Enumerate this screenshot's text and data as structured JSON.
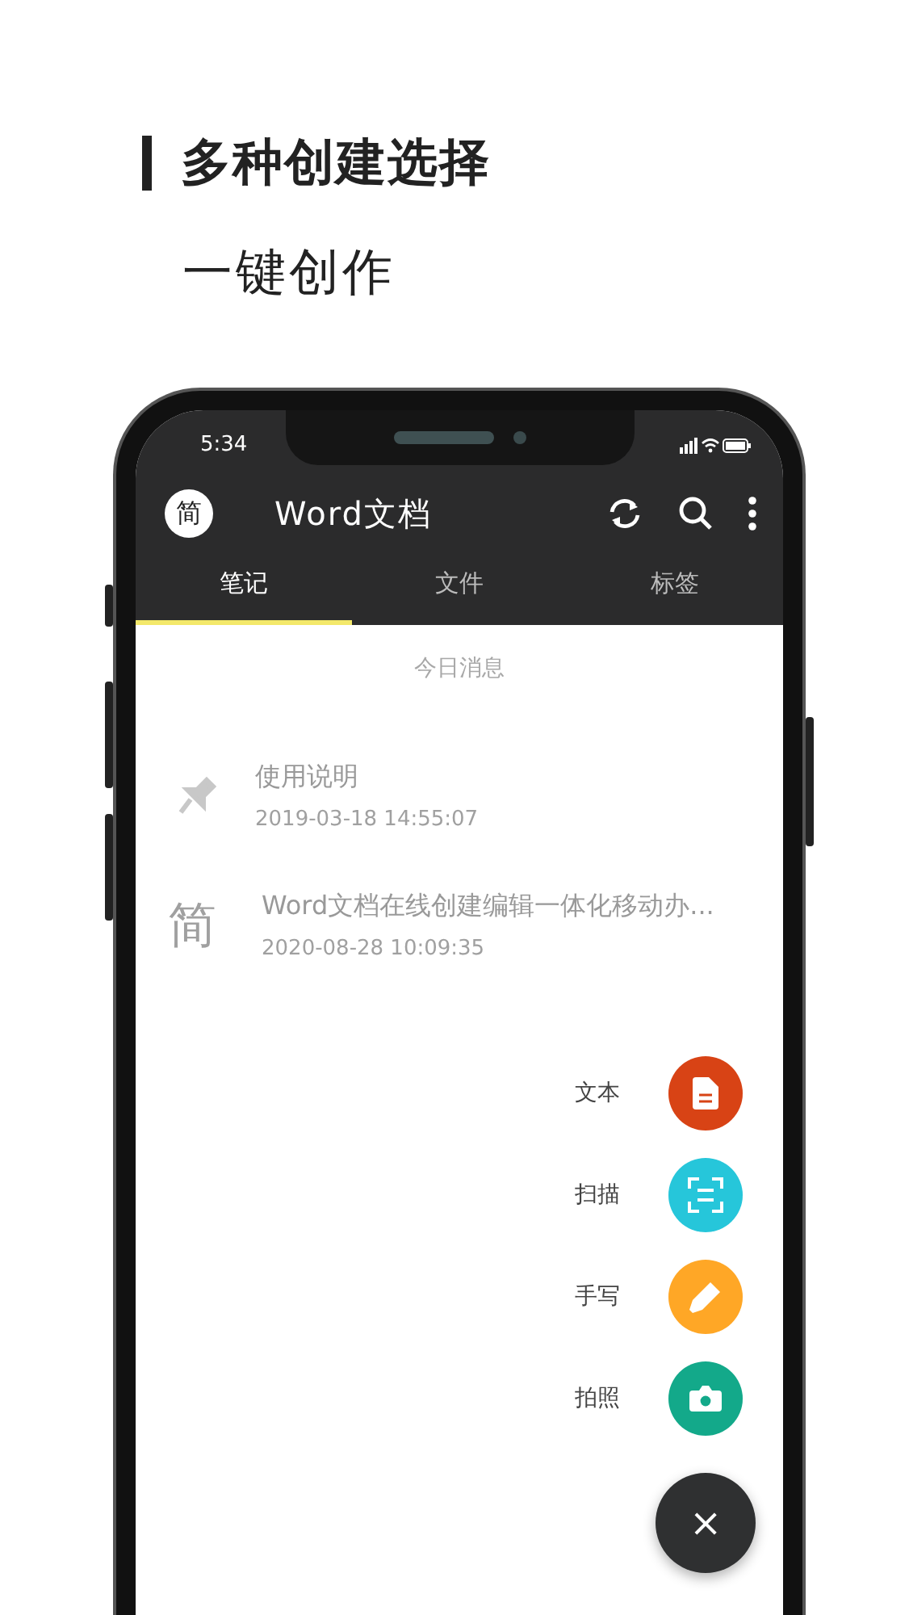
{
  "headline": {
    "title": "多种创建选择",
    "subtitle": "一键创作"
  },
  "status_bar": {
    "time": "5:34"
  },
  "app_bar": {
    "avatar": "简",
    "title": "Word文档"
  },
  "tabs": [
    {
      "label": "笔记",
      "selected": true
    },
    {
      "label": "文件",
      "selected": false
    },
    {
      "label": "标签",
      "selected": false
    }
  ],
  "section_title": "今日消息",
  "notes": [
    {
      "kind": "pin",
      "title": "使用说明",
      "date": "2019-03-18 14:55:07"
    },
    {
      "kind": "glyph",
      "icon_text": "简",
      "title": "Word文档在线创建编辑一体化移动办...",
      "date": "2020-08-28 10:09:35"
    }
  ],
  "fab_menu": [
    {
      "kind": "document",
      "label": "文本",
      "color": "#d84315"
    },
    {
      "kind": "scan",
      "label": "扫描",
      "color": "#26c6da"
    },
    {
      "kind": "pen",
      "label": "手写",
      "color": "#ffa726"
    },
    {
      "kind": "camera",
      "label": "拍照",
      "color": "#13a98a"
    }
  ],
  "close_button": {
    "symbol": "×"
  }
}
